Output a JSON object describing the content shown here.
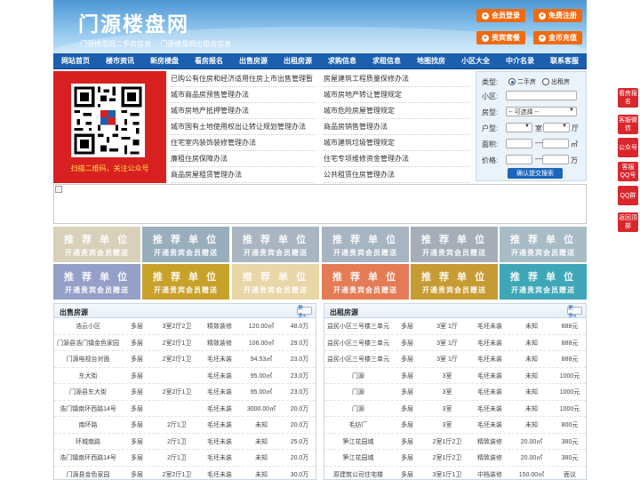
{
  "header": {
    "title": "门源楼盘网",
    "subtitle": [
      "门源楼盘网二手房信息",
      "门源楼盘网出租房信息"
    ],
    "buttons": [
      {
        "label": "会员登录",
        "icon": "user-icon"
      },
      {
        "label": "免费注册",
        "icon": "register-icon"
      },
      {
        "label": "贵宾套餐",
        "icon": "vip-icon"
      },
      {
        "label": "金币充值",
        "icon": "coin-icon"
      }
    ]
  },
  "nav": [
    "网站首页",
    "楼市资讯",
    "新房楼盘",
    "看房报名",
    "出售房源",
    "出租房源",
    "求购信息",
    "求租信息",
    "地图找房",
    "小区大全",
    "中介名录",
    "联系客服"
  ],
  "qr": {
    "caption": "扫描二维码，关注公众号"
  },
  "news": {
    "left": [
      "已购公有住房和经济适用住房上市出售管理暂",
      "城市商品房预售管理办法",
      "城市房地产抵押管理办法",
      "城市国有土地使用权出让转让规划管理办法",
      "住宅室内装饰装修管理办法",
      "廉租住房保障办法",
      "商品房屋租赁管理办法"
    ],
    "right": [
      "房屋建筑工程质量保修办法",
      "城市房地产转让管理规定",
      "城市危险房屋管理规定",
      "商品房销售管理办法",
      "城市建筑垃圾管理规定",
      "住宅专项维修资金管理办法",
      "公共租赁住房管理办法"
    ]
  },
  "search": {
    "type_label": "类型:",
    "type_options": [
      "二手房",
      "出租房"
    ],
    "community_label": "小区:",
    "housetype_label": "房型:",
    "housetype_value": "-- 可选择 --",
    "layout_label": "户型:",
    "room_unit": "室",
    "hall_unit": "厅",
    "area_label": "面积:",
    "area_unit": "㎡",
    "price_label": "价格:",
    "price_unit": "万",
    "submit": "确认提交搜索"
  },
  "promo": {
    "title": "推 荐 单 位",
    "subtitle": "开通贵宾会员赠送",
    "colors": [
      "#d8d0b8",
      "#99aebd",
      "#a9b6c2",
      "#a7b4c1",
      "#a5aeb8",
      "#a8bcc6",
      "#94a0c8",
      "#c8a12a",
      "#e8d6a6",
      "#e57b55",
      "#c79b33",
      "#3ea7b7"
    ]
  },
  "sale": {
    "title": "出售房源",
    "more": "更多»",
    "rows": [
      [
        "浩云小区",
        "多层",
        "3室2厅2卫",
        "精致装修",
        "120.00㎡",
        "48.0万"
      ],
      [
        "门源县浩门镇金色家园",
        "多层",
        "2室2厅1卫",
        "精致装修",
        "106.00㎡",
        "29.0万"
      ],
      [
        "门源电视台对面",
        "多层",
        "2室2厅1卫",
        "毛坯未装",
        "94.53㎡",
        "23.0万"
      ],
      [
        "东大街",
        "多层",
        "",
        "毛坯未装",
        "95.00㎡",
        "23.0万"
      ],
      [
        "门源县东大街",
        "多层",
        "2室2厅1卫",
        "毛坯未装",
        "95.00㎡",
        "23.0万"
      ],
      [
        "浩门镇南环西路14号",
        "多层",
        "",
        "毛坯未装",
        "3000.00㎡",
        "20.0万"
      ],
      [
        "南环路",
        "多层",
        "2厅1卫",
        "毛坯未装",
        "未知",
        "20.0万"
      ],
      [
        "环城南路",
        "多层",
        "2厅1卫",
        "毛坯未装",
        "未知",
        "25.0万"
      ],
      [
        "浩门镇南环西路14号",
        "多层",
        "2厅1卫",
        "毛坯未装",
        "未知",
        "20.0万"
      ],
      [
        "门源县金色家园",
        "多层",
        "2室2厅1卫",
        "毛坯未装",
        "未知",
        "30.0万"
      ]
    ]
  },
  "rent": {
    "title": "出租房源",
    "more": "更多»",
    "rows": [
      [
        "益民小区三号楼三单元",
        "多层",
        "3室 1厅",
        "毛坯未装",
        "未知",
        "888元"
      ],
      [
        "益民小区三号楼三单元",
        "多层",
        "3室 1厅",
        "毛坯未装",
        "未知",
        "888元"
      ],
      [
        "益民小区三号楼三单元",
        "多层",
        "3室 1厅",
        "毛坯未装",
        "未知",
        "888元"
      ],
      [
        "门源",
        "多层",
        "3室",
        "毛坯未装",
        "未知",
        "1000元"
      ],
      [
        "门源",
        "多层",
        "3室",
        "毛坯未装",
        "未知",
        "1000元"
      ],
      [
        "门源",
        "多层",
        "3室",
        "毛坯未装",
        "未知",
        "1000元"
      ],
      [
        "毛纺厂",
        "多层",
        "3室",
        "毛坯未装",
        "未知",
        "800元"
      ],
      [
        "笋江花园城",
        "多层",
        "2室1厅2卫",
        "精致装修",
        "20.00㎡",
        "380元"
      ],
      [
        "笋江花园城",
        "多层",
        "2室1厅2卫",
        "精致装修",
        "20.00㎡",
        "380元"
      ],
      [
        "原建筑公司住宅楼",
        "多层",
        "3室1厅1卫",
        "中档装修",
        "150.00㎡",
        "面议"
      ]
    ]
  },
  "float": [
    "看房报名",
    "客服微信",
    "公众号",
    "客服QQ号",
    "QQ群",
    "返回顶部"
  ]
}
